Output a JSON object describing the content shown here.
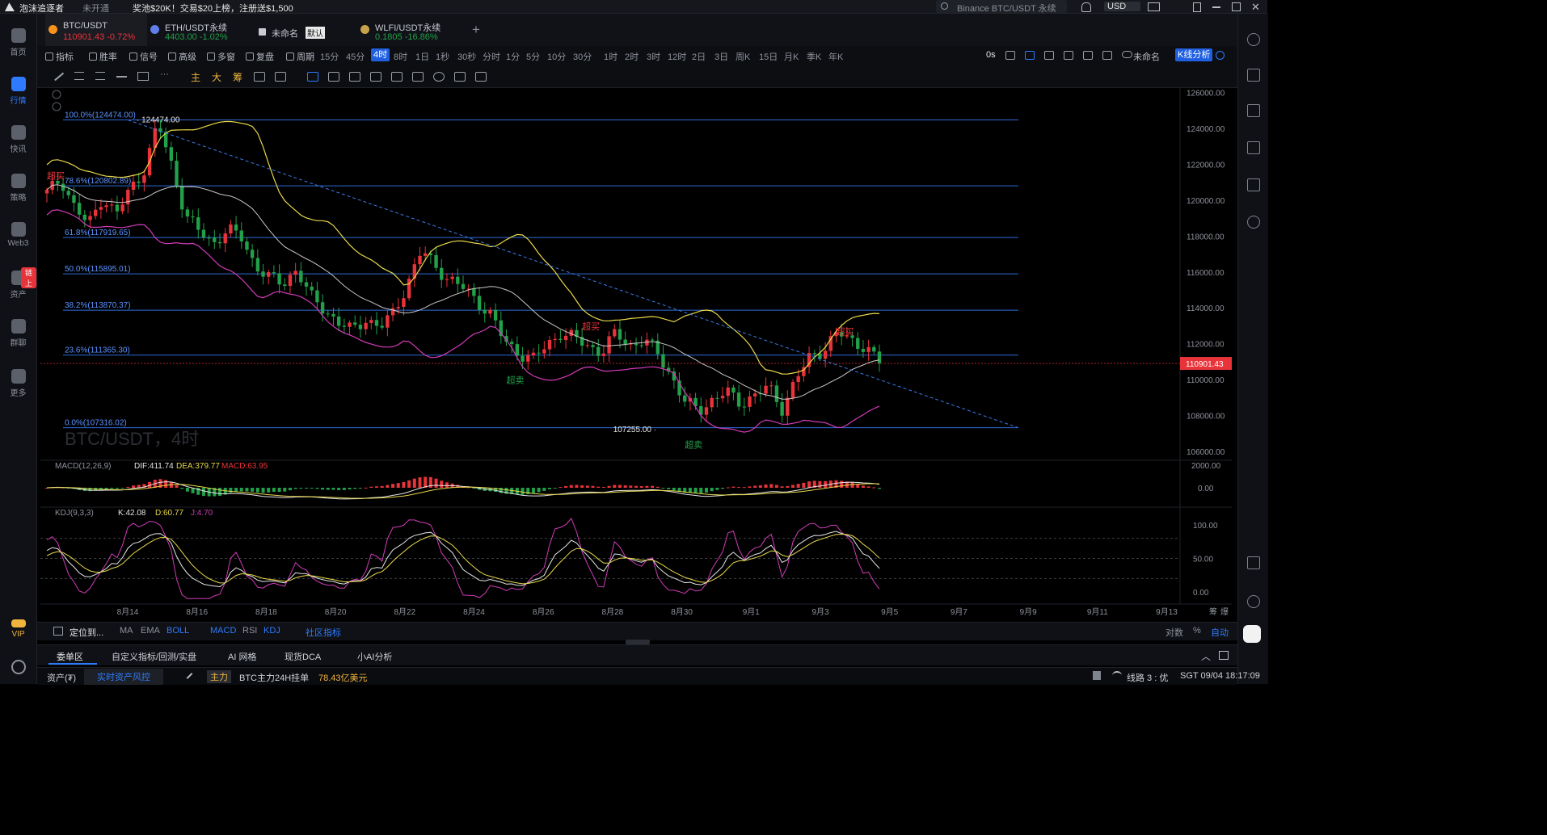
{
  "top": {
    "brand": "泡沫追逐者",
    "status": "未开通",
    "promo": "奖池$20K！交易$20上榜，注册送$1,500",
    "search_placeholder": "Binance BTC/USDT 永续",
    "currency": "USD"
  },
  "leftnav": [
    {
      "label": "首页",
      "icon": "home-icon"
    },
    {
      "label": "行情",
      "icon": "market-chart-icon"
    },
    {
      "label": "快讯",
      "icon": "news-icon"
    },
    {
      "label": "策略",
      "icon": "strategy-robot-icon"
    },
    {
      "label": "Web3",
      "icon": "web3-icon"
    },
    {
      "label": "资产",
      "icon": "wallet-icon",
      "badge": "链上"
    },
    {
      "label": "群聊",
      "icon": "chat-icon"
    },
    {
      "label": "更多",
      "icon": "more-grid-icon"
    }
  ],
  "leftnav_vip": "VIP",
  "tabs": [
    {
      "name": "BTC/USDT",
      "price": "110901.43",
      "change": "-0.72%",
      "coin_color": "#f7931a"
    },
    {
      "name": "ETH/USDT永续",
      "price": "4403.00",
      "change": "-1.02%",
      "coin_color": "#627eea"
    },
    {
      "name": "未命名",
      "tag": "默认"
    },
    {
      "name": "WLFI/USDT永续",
      "price": "0.1805",
      "change": "-16.86%",
      "coin_color": "#c8a24a"
    }
  ],
  "toolbar": {
    "buttons": [
      "指标",
      "胜率",
      "信号",
      "高级",
      "多窗",
      "复盘",
      "周期"
    ],
    "periods": [
      "15分",
      "45分",
      "4时",
      "8时",
      "1日",
      "1秒",
      "30秒",
      "分时",
      "1分",
      "5分",
      "10分",
      "30分",
      "1时",
      "2时",
      "3时",
      "12时",
      "2日",
      "3日",
      "周K",
      "15日",
      "月K",
      "季K",
      "年K"
    ],
    "active_period": "4时",
    "countdown": "0s",
    "layout_name": "未命名",
    "analysis_btn": "K线分析"
  },
  "draw_labels": [
    "主",
    "大",
    "筹"
  ],
  "colors": {
    "up": "#e8333a",
    "down": "#22a04a",
    "accent": "#2f7bff",
    "fib": "#2f6bd9",
    "boll_upper": "#e8d84a",
    "boll_mid": "#c9c9c9",
    "boll_lower": "#d13bb8"
  },
  "chart_data": [
    {
      "type": "candlestick",
      "symbol": "BTC/USDT",
      "watermark": "BTC/USDT，4时",
      "x_ticks": [
        "8月14",
        "8月16",
        "8月18",
        "8月20",
        "8月22",
        "8月24",
        "8月26",
        "8月28",
        "8月30",
        "9月1",
        "9月3",
        "9月5",
        "9月7",
        "9月9",
        "9月11",
        "9月13"
      ],
      "y_ticks": [
        "126000.00",
        "124000.00",
        "122000.00",
        "120000.00",
        "118000.00",
        "116000.00",
        "114000.00",
        "112000.00",
        "110000.00",
        "108000.00",
        "106000.00"
      ],
      "ylim": [
        105500,
        126300
      ],
      "last_price": "110901.43",
      "high_label": "124474.00",
      "low_label": "107255.00",
      "fib_levels": [
        {
          "label": "100.0%(124474.00)",
          "value": 124474.0
        },
        {
          "label": "78.6%(120802.89)",
          "value": 120802.89
        },
        {
          "label": "61.8%(117919.65)",
          "value": 117919.65
        },
        {
          "label": "50.0%(115895.01)",
          "value": 115895.01
        },
        {
          "label": "38.2%(113870.37)",
          "value": 113870.37
        },
        {
          "label": "23.6%(111365.30)",
          "value": 111365.3
        },
        {
          "label": "0.0%(107316.02)",
          "value": 107316.02
        }
      ],
      "trendline": [
        {
          "x": "8月14",
          "y": 124474.0
        },
        {
          "x": "9月5",
          "y": 107316.0
        }
      ],
      "signals": [
        {
          "text": "超买",
          "x_idx": 0,
          "price": 121200,
          "kind": "overbought"
        },
        {
          "text": "超买",
          "x_idx": 99,
          "price": 112800,
          "kind": "overbought"
        },
        {
          "text": "超卖",
          "x_idx": 85,
          "price": 109800,
          "kind": "oversold"
        },
        {
          "text": "超卖",
          "x_idx": 118,
          "price": 106200,
          "kind": "oversold"
        },
        {
          "text": "超买",
          "x_idx": 146,
          "price": 112500,
          "kind": "overbought"
        }
      ],
      "ohlc_anchor_closes": [
        120400,
        121200,
        119600,
        118600,
        120200,
        119200,
        120600,
        121700,
        124300,
        121900,
        119200,
        118200,
        117600,
        118400,
        117900,
        116400,
        115700,
        115300,
        116200,
        114600,
        113900,
        113200,
        112700,
        113400,
        112900,
        113700,
        115400,
        117200,
        116300,
        115600,
        115100,
        114400,
        113600,
        112100,
        111500,
        111100,
        111900,
        112600,
        112300,
        111900,
        111500,
        112600,
        111900,
        112200,
        111500,
        110200,
        108700,
        108300,
        108900,
        109300,
        108700,
        109100,
        109600,
        108400,
        110000,
        111300,
        111700,
        112600,
        112200,
        111800,
        110900
      ]
    },
    {
      "type": "macd",
      "label": "MACD(12,26,9)",
      "dif_label": "DIF:411.74",
      "dea_label": "DEA:379.77",
      "macd_label": "MACD:63.95",
      "y_ticks": [
        "2000.00",
        "0.00"
      ]
    },
    {
      "type": "kdj",
      "label": "KDJ(9,3,3)",
      "k_label": "K:42.08",
      "d_label": "D:60.77",
      "j_label": "J:4.70",
      "y_ticks": [
        "100.00",
        "50.00",
        "0.00"
      ]
    }
  ],
  "bottom": {
    "locate": "定位到...",
    "indicators_main": [
      "MA",
      "EMA",
      "BOLL"
    ],
    "indicators_sub": [
      "MACD",
      "RSI",
      "KDJ"
    ],
    "community": "社区指标",
    "scale_opts": [
      "对数",
      "%",
      "自动"
    ],
    "tabs": [
      "委单区",
      "自定义指标/回测/实盘",
      "AI 网格",
      "现货DCA",
      "小AI分析"
    ],
    "asset": "资产(₮)",
    "risk": "实时资产风控",
    "main_force_tag": "主力",
    "main_force_text": "BTC主力24H挂单",
    "main_force_value": "78.43亿美元",
    "line_status": "线路 3 : 优",
    "time": "SGT 09/04 18:17:09"
  }
}
